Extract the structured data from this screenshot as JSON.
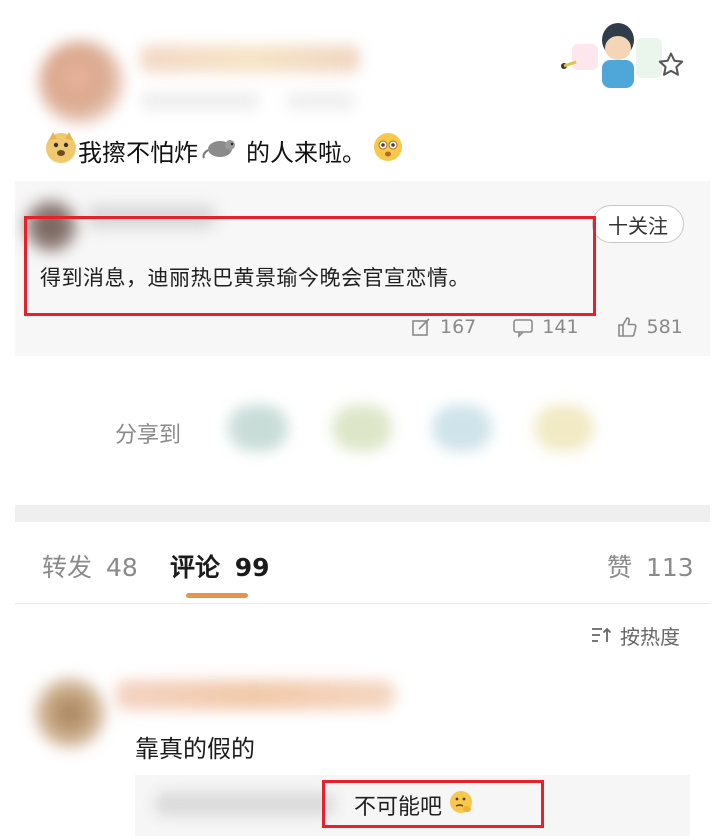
{
  "post": {
    "text_before": "我擦不怕炸",
    "text_after": "的人来啦。",
    "emojis": [
      "doge-emoji",
      "rat-emoji",
      "shocked-emoji"
    ]
  },
  "repost": {
    "follow_label": "十关注",
    "text": "得到消息，迪丽热巴黄景瑜今晚会官宣恋情。",
    "stats": {
      "reposts": "167",
      "comments": "141",
      "likes": "581"
    }
  },
  "share": {
    "label": "分享到"
  },
  "tabs": {
    "repost_label": "转发",
    "repost_count": "48",
    "comments_label": "评论",
    "comments_count": "99",
    "likes_label": "赞",
    "likes_count": "113"
  },
  "sort": {
    "label": "按热度"
  },
  "comment": {
    "text": "靠真的假的",
    "reply_text": "不可能吧"
  },
  "colors": {
    "highlight": "#e8202a",
    "tab_accent": "#e8934b"
  }
}
